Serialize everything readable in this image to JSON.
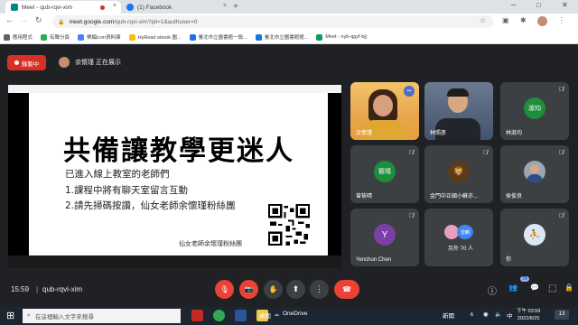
{
  "browser": {
    "tabs": [
      {
        "title": "Meet - qub-rqvi-xim",
        "close": "×"
      },
      {
        "title": "(1) Facebook",
        "close": "×"
      }
    ],
    "new_tab": "+",
    "win_min": "─",
    "win_max": "□",
    "win_close": "✕",
    "url_main": "meet.google.com",
    "url_rest": "/qub-rqvi-xim?pli=1&authuser=0",
    "nav_back": "←",
    "nav_forward": "→",
    "nav_reload": "↻",
    "bookmarks": [
      {
        "label": "應用程式",
        "color": "#5f6368"
      },
      {
        "label": "有聲分頁",
        "color": "#34a853"
      },
      {
        "label": "樂編icon資料庫",
        "color": "#4285f4"
      },
      {
        "label": "HyRead ebook 圖...",
        "color": "#fbbc04"
      },
      {
        "label": "臺北市立圖書館一設...",
        "color": "#1a73e8"
      },
      {
        "label": "臺北市立圖書館館...",
        "color": "#1a73e8"
      },
      {
        "label": "Meet - oyb-qgyf-bjj",
        "color": "#0f9d58"
      }
    ]
  },
  "meet": {
    "recording_label": "錄製中",
    "presenting_text": "余懷瑾 正在展示",
    "slide": {
      "title": "共備讓教學更迷人",
      "lines": [
        "已進入線上教室的老師們",
        "1.課程中將有聊天室留言互動",
        "2.請先掃碼按讚，仙女老師余懷瑾粉絲團"
      ],
      "footer": "仙女老師余懷瑾粉絲團"
    },
    "tiles": [
      {
        "name": "余懷瑾",
        "initials": "",
        "color": "#f2c46b"
      },
      {
        "name": "林照彥",
        "initials": "",
        "color": "#55657c"
      },
      {
        "name": "林淑均",
        "initials": "淑均",
        "color": "#1e8e3e"
      },
      {
        "name": "曾筱晴",
        "initials": "筱晴",
        "color": "#1e8e3e"
      },
      {
        "name": "金門中正國小蘇亦...",
        "initials": "",
        "color": "#3c4043"
      },
      {
        "name": "侯俊良",
        "initials": "",
        "color": "#3c4043"
      },
      {
        "name": "Yenchun Chen",
        "initials": "Y",
        "color": "#7b3fa5"
      },
      {
        "name": "另外 70 人",
        "initials": "",
        "color": "#3c4043"
      },
      {
        "name": "你",
        "initials": "",
        "color": "#3c4043"
      }
    ],
    "more_icon": "•••",
    "others_badge": "曾麟",
    "time": "15:59",
    "separator": "|",
    "meeting_code": "qub-rqvi-xim",
    "controls": {
      "mic": "🎙",
      "cam": "📷",
      "hand": "✋",
      "present": "⬆",
      "more": "⋮",
      "end": "☎"
    },
    "right_controls": {
      "info": "ⓘ",
      "people": "👥",
      "chat": "💬",
      "activities": "⬚",
      "lock": "🔒"
    },
    "participants_count": "79"
  },
  "taskbar": {
    "start_icon": "⊞",
    "search_placeholder": "在這裡輸入文字來搜尋",
    "search_icon": "⌕",
    "apps": [
      {
        "name": "pdf",
        "color": "#c62828"
      },
      {
        "name": "chrome",
        "color": "#34a853"
      },
      {
        "name": "word",
        "color": "#2b579a"
      },
      {
        "name": "explorer",
        "color": "#f2c94c"
      }
    ],
    "desktop_label": "桌面",
    "onedrive_label": "OneDrive",
    "news_label": "新聞",
    "ime": "中",
    "clock_time": "下午 03:59",
    "clock_date": "2022/8/25",
    "notif_count": "13"
  }
}
